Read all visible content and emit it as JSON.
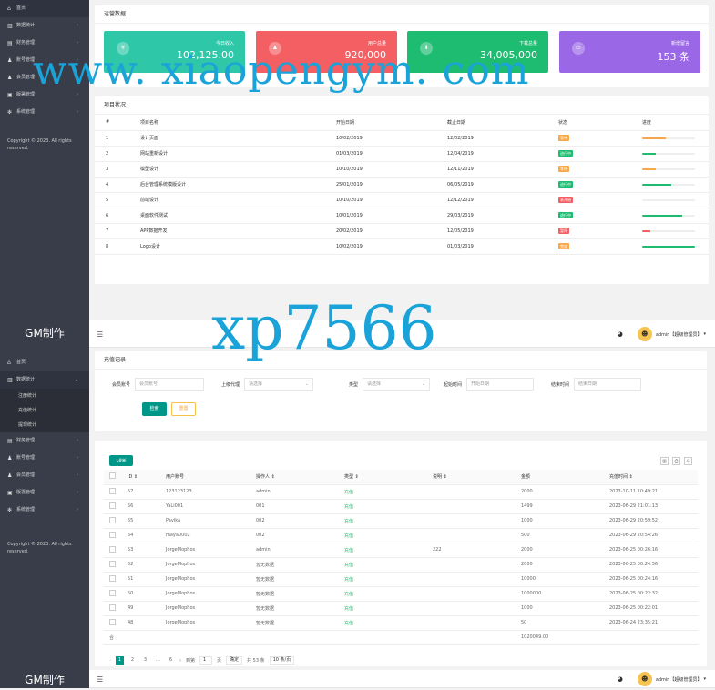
{
  "top": {
    "nav": [
      {
        "icon": "home-icon",
        "glyph": "⌂",
        "label": "首页",
        "arrow": ""
      },
      {
        "icon": "chart-icon",
        "glyph": "▥",
        "label": "数据统计",
        "arrow": "›"
      },
      {
        "icon": "bank-icon",
        "glyph": "▤",
        "label": "财务管理",
        "arrow": "›"
      },
      {
        "icon": "user-icon",
        "glyph": "♟",
        "label": "账号管理",
        "arrow": "›"
      },
      {
        "icon": "users-icon",
        "glyph": "♟",
        "label": "会员管理",
        "arrow": "›"
      },
      {
        "icon": "server-icon",
        "glyph": "▣",
        "label": "版署管理",
        "arrow": "›"
      },
      {
        "icon": "gear-icon",
        "glyph": "✻",
        "label": "系统管理",
        "arrow": "›"
      }
    ],
    "copyright_1": "Copyright © 2023. All rights",
    "copyright_2": "reserved.",
    "stats_title": "运营数据",
    "stats": [
      {
        "icon": "yen-icon",
        "glyph": "¥",
        "label": "今日收入",
        "value": "102,125.00",
        "color": "#2ec7a8"
      },
      {
        "icon": "user-icon",
        "glyph": "♟",
        "label": "用户总量",
        "value": "920,000",
        "color": "#f45f63"
      },
      {
        "icon": "download-icon",
        "glyph": "⬇",
        "label": "下载总量",
        "value": "34,005,000",
        "color": "#1ebc71"
      },
      {
        "icon": "message-icon",
        "glyph": "▭",
        "label": "新增留言",
        "value": "153 条",
        "color": "#9a67e6"
      }
    ],
    "progress_title": "项目状况",
    "progress_headers": [
      "#",
      "项目名称",
      "开始日期",
      "截止日期",
      "状态",
      "进度"
    ],
    "projects": [
      {
        "no": "1",
        "name": "设计页面",
        "start": "10/02/2019",
        "end": "12/02/2019",
        "status": "等待",
        "status_color": "#f7a84a",
        "progress": 0.45,
        "bar_color": "#f7a84a"
      },
      {
        "no": "2",
        "name": "网站重新设计",
        "start": "01/03/2019",
        "end": "12/04/2019",
        "status": "进行中",
        "status_color": "#1ebc71",
        "progress": 0.25,
        "bar_color": "#1ebc71"
      },
      {
        "no": "3",
        "name": "模型设计",
        "start": "10/10/2019",
        "end": "12/11/2019",
        "status": "等待",
        "status_color": "#f7a84a",
        "progress": 0.25,
        "bar_color": "#f7a84a"
      },
      {
        "no": "4",
        "name": "后台管理系统模版设计",
        "start": "25/01/2019",
        "end": "06/05/2019",
        "status": "进行中",
        "status_color": "#1ebc71",
        "progress": 0.55,
        "bar_color": "#1ebc71"
      },
      {
        "no": "5",
        "name": "前端设计",
        "start": "10/10/2019",
        "end": "12/12/2019",
        "status": "未开始",
        "status_color": "#f45f63",
        "progress": 0.0,
        "bar_color": "#f45f63"
      },
      {
        "no": "6",
        "name": "桌面软件测试",
        "start": "10/01/2019",
        "end": "29/03/2019",
        "status": "进行中",
        "status_color": "#1ebc71",
        "progress": 0.75,
        "bar_color": "#1ebc71"
      },
      {
        "no": "7",
        "name": "APP数据开发",
        "start": "20/02/2019",
        "end": "12/05/2019",
        "status": "暂停",
        "status_color": "#f45f63",
        "progress": 0.15,
        "bar_color": "#f45f63"
      },
      {
        "no": "8",
        "name": "Logo设计",
        "start": "10/02/2019",
        "end": "01/03/2019",
        "status": "完成",
        "status_color": "#f7a84a",
        "progress": 1.0,
        "bar_color": "#1ebc71"
      }
    ]
  },
  "bottom": {
    "logo": "GM制作",
    "nav": [
      {
        "icon": "home-icon",
        "glyph": "⌂",
        "label": "首页",
        "arrow": "",
        "kind": "item"
      },
      {
        "icon": "chart-icon",
        "glyph": "▥",
        "label": "数据统计",
        "arrow": "⌄",
        "kind": "active"
      },
      {
        "icon": "",
        "glyph": "",
        "label": "注册统计",
        "arrow": "",
        "kind": "sub"
      },
      {
        "icon": "",
        "glyph": "",
        "label": "充值统计",
        "arrow": "",
        "kind": "sub"
      },
      {
        "icon": "",
        "glyph": "",
        "label": "提现统计",
        "arrow": "",
        "kind": "sub"
      },
      {
        "icon": "bank-icon",
        "glyph": "▤",
        "label": "财务管理",
        "arrow": "›",
        "kind": "item"
      },
      {
        "icon": "user-icon",
        "glyph": "♟",
        "label": "账号管理",
        "arrow": "›",
        "kind": "item"
      },
      {
        "icon": "users-icon",
        "glyph": "♟",
        "label": "会员管理",
        "arrow": "›",
        "kind": "item"
      },
      {
        "icon": "server-icon",
        "glyph": "▣",
        "label": "版署管理",
        "arrow": "›",
        "kind": "item"
      },
      {
        "icon": "gear-icon",
        "glyph": "✻",
        "label": "系统管理",
        "arrow": "›",
        "kind": "item"
      }
    ],
    "copyright_1": "Copyright © 2023. All rights",
    "copyright_2": "reserved.",
    "user_label": "admin【超级管理员】",
    "card_title": "充值记录",
    "filters": [
      {
        "label": "会员账号",
        "placeholder": "会员账号",
        "dropdown": false
      },
      {
        "label": "上级代理",
        "placeholder": "请选择",
        "dropdown": true
      },
      {
        "label": "类型",
        "placeholder": "请选择",
        "dropdown": true
      },
      {
        "label": "起始时间",
        "placeholder": "开始日期",
        "dropdown": false
      },
      {
        "label": "结束时间",
        "placeholder": "结束日期",
        "dropdown": false
      }
    ],
    "search_label": "检索",
    "reset_label": "重置",
    "refresh_label": "刷新",
    "headers": [
      "ID ⇕",
      "用户账号",
      "操作人 ⇕",
      "类型 ⇕",
      "说明 ⇕",
      "金额",
      "充值时间 ⇕"
    ],
    "rows": [
      {
        "id": "57",
        "account": "123123123",
        "operator": "admin",
        "type": "充值",
        "note": "",
        "amount": "2000",
        "time": "2023-10-11 10:49:21"
      },
      {
        "id": "56",
        "account": "YaLi001",
        "operator": "001",
        "type": "充值",
        "note": "",
        "amount": "1499",
        "time": "2023-06-29 21:01:13"
      },
      {
        "id": "55",
        "account": "Pavlka",
        "operator": "002",
        "type": "充值",
        "note": "",
        "amount": "1000",
        "time": "2023-06-29 20:59:52"
      },
      {
        "id": "54",
        "account": "maya0002",
        "operator": "002",
        "type": "充值",
        "note": "",
        "amount": "500",
        "time": "2023-06-29 20:54:26"
      },
      {
        "id": "53",
        "account": "JorgeMophos",
        "operator": "admin",
        "type": "充值",
        "note": "222",
        "amount": "2000",
        "time": "2023-06-25 00:26:16"
      },
      {
        "id": "52",
        "account": "JorgeMophos",
        "operator": "暂无数据",
        "type": "充值",
        "note": "",
        "amount": "2000",
        "time": "2023-06-25 00:24:56"
      },
      {
        "id": "51",
        "account": "JorgeMophos",
        "operator": "暂无数据",
        "type": "充值",
        "note": "",
        "amount": "10000",
        "time": "2023-06-25 00:24:16"
      },
      {
        "id": "50",
        "account": "JorgeMophos",
        "operator": "暂无数据",
        "type": "充值",
        "note": "",
        "amount": "1000000",
        "time": "2023-06-25 00:22:32"
      },
      {
        "id": "49",
        "account": "JorgeMophos",
        "operator": "暂无数据",
        "type": "充值",
        "note": "",
        "amount": "1000",
        "time": "2023-06-25 00:22:01"
      },
      {
        "id": "48",
        "account": "JorgeMophos",
        "operator": "暂无数据",
        "type": "充值",
        "note": "",
        "amount": "50",
        "time": "2023-06-24 23:35:21"
      }
    ],
    "total_label": "合",
    "total_amount": "1020049.00",
    "pager": {
      "pages": [
        "1",
        "2",
        "3",
        "…",
        "6"
      ],
      "next": "›",
      "goto": "到第",
      "page_input": "1",
      "page_unit": "页",
      "confirm": "确定",
      "total": "共 53 条",
      "per_page": "10 条/页"
    },
    "footer_logo": "GM制作",
    "footer_user": "admin【超级管理员】"
  },
  "watermark_1": "www. xiaopengym. com",
  "watermark_2": "xp7566"
}
